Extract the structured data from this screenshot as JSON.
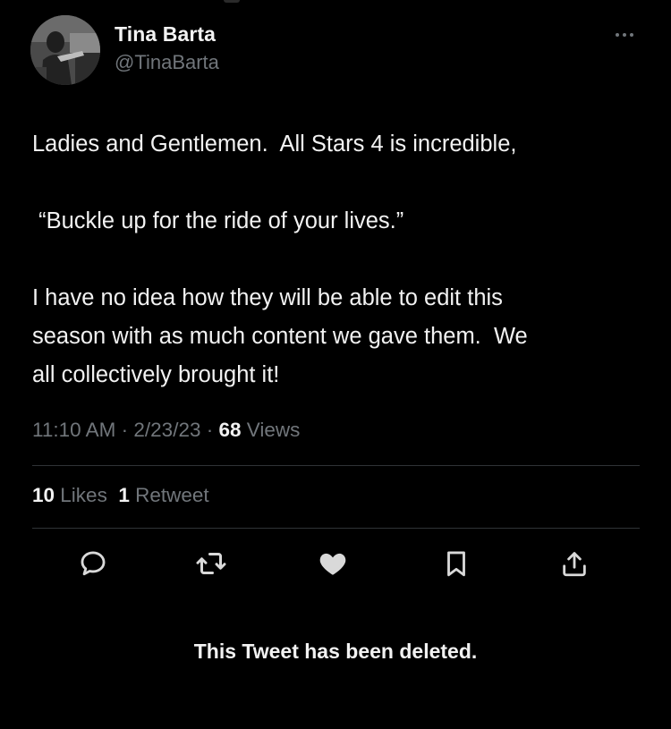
{
  "author": {
    "display_name": "Tina Barta",
    "handle": "@TinaBarta",
    "avatar_icon": "profile-photo"
  },
  "tweet": {
    "lines": [
      "Ladies and Gentlemen.  All Stars 4 is incredible,",
      " “Buckle up for the ride of your lives.”",
      "I have no idea how they will be able to edit this",
      "season with as much content we gave them.  We",
      "all collectively brought it!"
    ]
  },
  "meta": {
    "time": "11:10 AM",
    "separator": " · ",
    "date": "2/23/23",
    "views_count": "68",
    "views_label": "Views"
  },
  "engagement": {
    "likes_count": "10",
    "likes_label": "Likes",
    "retweets_count": "1",
    "retweets_label": "Retweet"
  },
  "actions": {
    "reply_icon": "speech-bubble",
    "retweet_icon": "retweet-arrows",
    "like_icon": "heart-filled",
    "bookmark_icon": "bookmark",
    "share_icon": "share-upload"
  },
  "deleted_notice": "This Tweet has been deleted.",
  "colors": {
    "background": "#000000",
    "text_primary": "#f2f2f2",
    "text_secondary": "#71767b",
    "divider": "#2f3336"
  }
}
